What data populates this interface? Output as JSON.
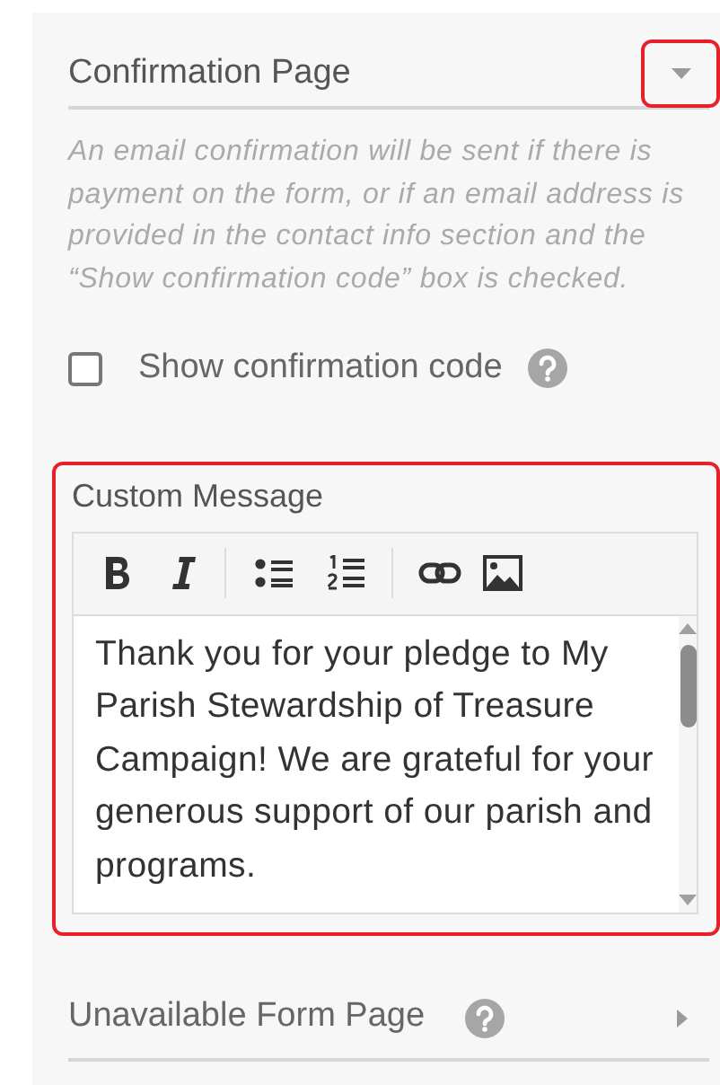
{
  "confirmation_page": {
    "title": "Confirmation Page",
    "highlighted": true,
    "description": "An email confirmation will be sent if there is payment on the form, or if an email address is provided in the contact info section and the “Show confirmation code” box is checked."
  },
  "show_confirmation_code": {
    "label": "Show confirmation code",
    "checked": false
  },
  "custom_message": {
    "label": "Custom Message",
    "highlighted": true,
    "text": "Thank you for your pledge to My Parish Stewardship of Treasure Campaign!  We are grateful for your generous support of our parish and programs."
  },
  "unavailable_form_page": {
    "title": "Unavailable Form Page"
  }
}
